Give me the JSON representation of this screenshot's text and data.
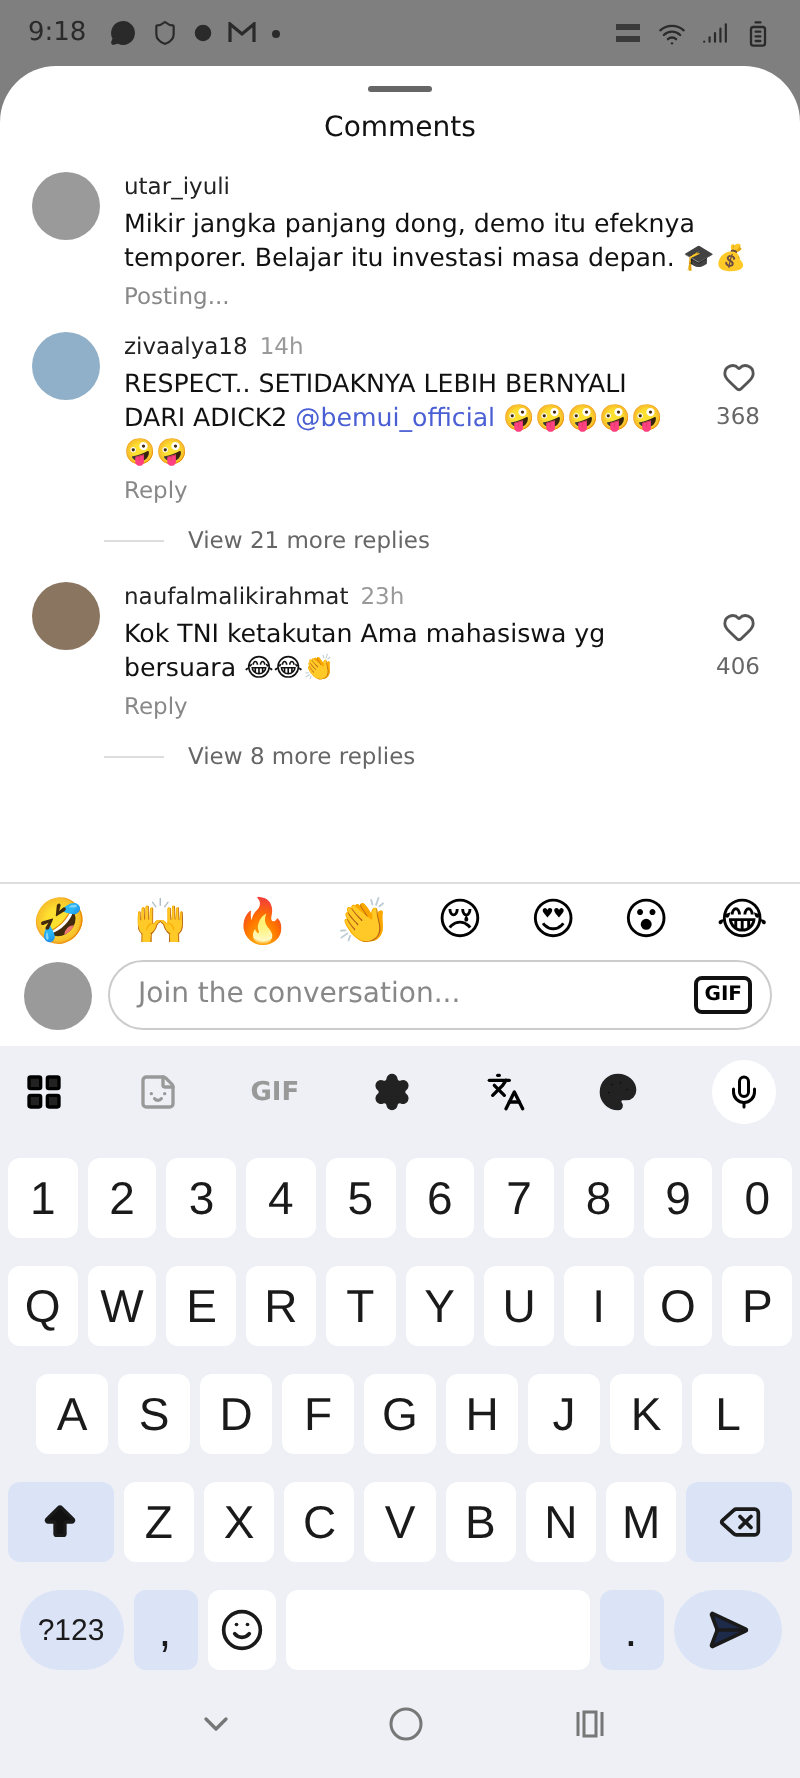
{
  "status_bar": {
    "time": "9:18"
  },
  "sheet": {
    "title": "Comments"
  },
  "comments": [
    {
      "user": "utar_iyuli",
      "parts": [
        {
          "kind": "plain",
          "text": "Mikir jangka panjang dong, demo itu efeknya temporer. Belajar itu investasi masa depan. 🎓💰"
        }
      ],
      "action": "Posting..."
    },
    {
      "user": "zivaalya18",
      "time": "14h",
      "parts": [
        {
          "kind": "plain",
          "text": "RESPECT.. SETIDAKNYA LEBIH BERNYALI DARI ADICK2 "
        },
        {
          "kind": "mention",
          "text": "@bemui_official"
        },
        {
          "kind": "plain",
          "text": " 🤪🤪🤪🤪🤪🤪🤪"
        }
      ],
      "action": "Reply",
      "likes": "368",
      "more_replies": "View 21 more replies"
    },
    {
      "user": "naufalmalikirahmat",
      "time": "23h",
      "parts": [
        {
          "kind": "plain",
          "text": "Kok TNI ketakutan Ama mahasiswa yg bersuara 😂😂👏"
        }
      ],
      "action": "Reply",
      "likes": "406",
      "more_replies": "View 8 more replies"
    }
  ],
  "reactions": [
    "🤣",
    "🙌",
    "🔥",
    "👏",
    "😢",
    "😍",
    "😮",
    "😂"
  ],
  "composer": {
    "placeholder": "Join the conversation...",
    "gif": "GIF"
  },
  "keyboard_toolbar": {
    "gif": "GIF"
  },
  "keyboard_rows": [
    [
      {
        "kind": "char",
        "label": "1"
      },
      {
        "kind": "char",
        "label": "2"
      },
      {
        "kind": "char",
        "label": "3"
      },
      {
        "kind": "char",
        "label": "4"
      },
      {
        "kind": "char",
        "label": "5"
      },
      {
        "kind": "char",
        "label": "6"
      },
      {
        "kind": "char",
        "label": "7"
      },
      {
        "kind": "char",
        "label": "8"
      },
      {
        "kind": "char",
        "label": "9"
      },
      {
        "kind": "char",
        "label": "0"
      }
    ],
    [
      {
        "kind": "char",
        "label": "Q"
      },
      {
        "kind": "char",
        "label": "W"
      },
      {
        "kind": "char",
        "label": "E"
      },
      {
        "kind": "char",
        "label": "R"
      },
      {
        "kind": "char",
        "label": "T"
      },
      {
        "kind": "char",
        "label": "Y"
      },
      {
        "kind": "char",
        "label": "U"
      },
      {
        "kind": "char",
        "label": "I"
      },
      {
        "kind": "char",
        "label": "O"
      },
      {
        "kind": "char",
        "label": "P"
      }
    ],
    [
      {
        "kind": "char",
        "label": "A"
      },
      {
        "kind": "char",
        "label": "S"
      },
      {
        "kind": "char",
        "label": "D"
      },
      {
        "kind": "char",
        "label": "F"
      },
      {
        "kind": "char",
        "label": "G"
      },
      {
        "kind": "char",
        "label": "H"
      },
      {
        "kind": "char",
        "label": "J"
      },
      {
        "kind": "char",
        "label": "K"
      },
      {
        "kind": "char",
        "label": "L"
      }
    ],
    [
      {
        "kind": "shift"
      },
      {
        "kind": "char",
        "label": "Z"
      },
      {
        "kind": "char",
        "label": "X"
      },
      {
        "kind": "char",
        "label": "C"
      },
      {
        "kind": "char",
        "label": "V"
      },
      {
        "kind": "char",
        "label": "B"
      },
      {
        "kind": "char",
        "label": "N"
      },
      {
        "kind": "char",
        "label": "M"
      },
      {
        "kind": "backspace"
      }
    ],
    [
      {
        "kind": "symbols",
        "label": "?123"
      },
      {
        "kind": "punct",
        "label": ","
      },
      {
        "kind": "emoji"
      },
      {
        "kind": "space"
      },
      {
        "kind": "punct",
        "label": "."
      },
      {
        "kind": "enter"
      }
    ]
  ]
}
